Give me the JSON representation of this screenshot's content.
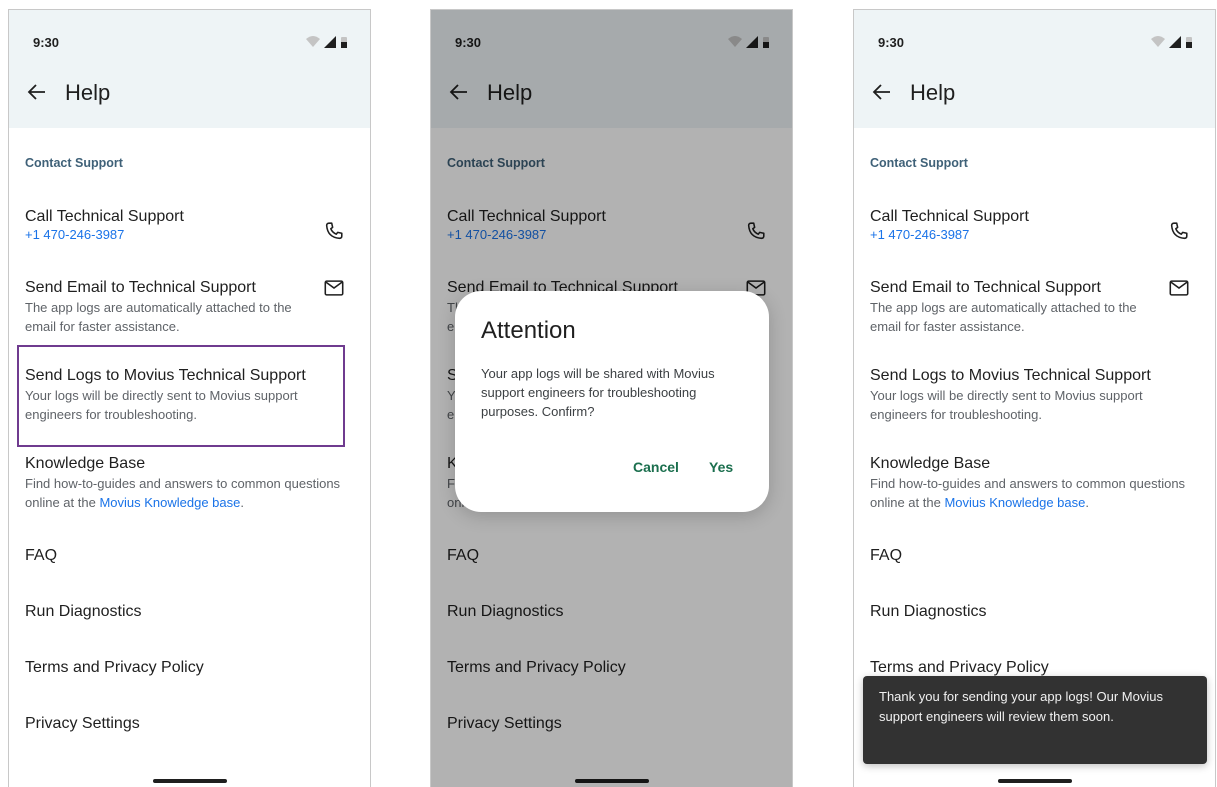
{
  "status_time": "9:30",
  "page_title": "Help",
  "section_header": "Contact Support",
  "call": {
    "title": "Call Technical Support",
    "phone": "+1 470-246-3987"
  },
  "email": {
    "title": "Send Email to Technical Support",
    "subtitle": "The app logs are automatically attached to the email for faster assistance."
  },
  "logs": {
    "title": "Send Logs to Movius Technical Support",
    "subtitle": "Your logs will be directly sent to Movius support engineers for troubleshooting."
  },
  "kb": {
    "title": "Knowledge Base",
    "subtitle_prefix": "Find how-to-guides and answers to common questions online at the ",
    "link_text": "Movius Knowledge base",
    "subtitle_suffix": "."
  },
  "menu": {
    "faq": "FAQ",
    "diagnostics": "Run Diagnostics",
    "terms": "Terms and Privacy Policy",
    "privacy": "Privacy Settings"
  },
  "dialog": {
    "title": "Attention",
    "body": "Your app logs will be shared with Movius support engineers for troubleshooting purposes. Confirm?",
    "cancel": "Cancel",
    "yes": "Yes"
  },
  "snackbar": {
    "message": "Thank you for sending your app logs! Our Movius support engineers will review them soon."
  },
  "colors": {
    "appbar": "#eef4f6",
    "section_header": "#3f6178",
    "link": "#1a73e8",
    "highlight": "#6f3b8f",
    "dialog_button": "#1b6f4e",
    "snackbar": "#323232"
  }
}
